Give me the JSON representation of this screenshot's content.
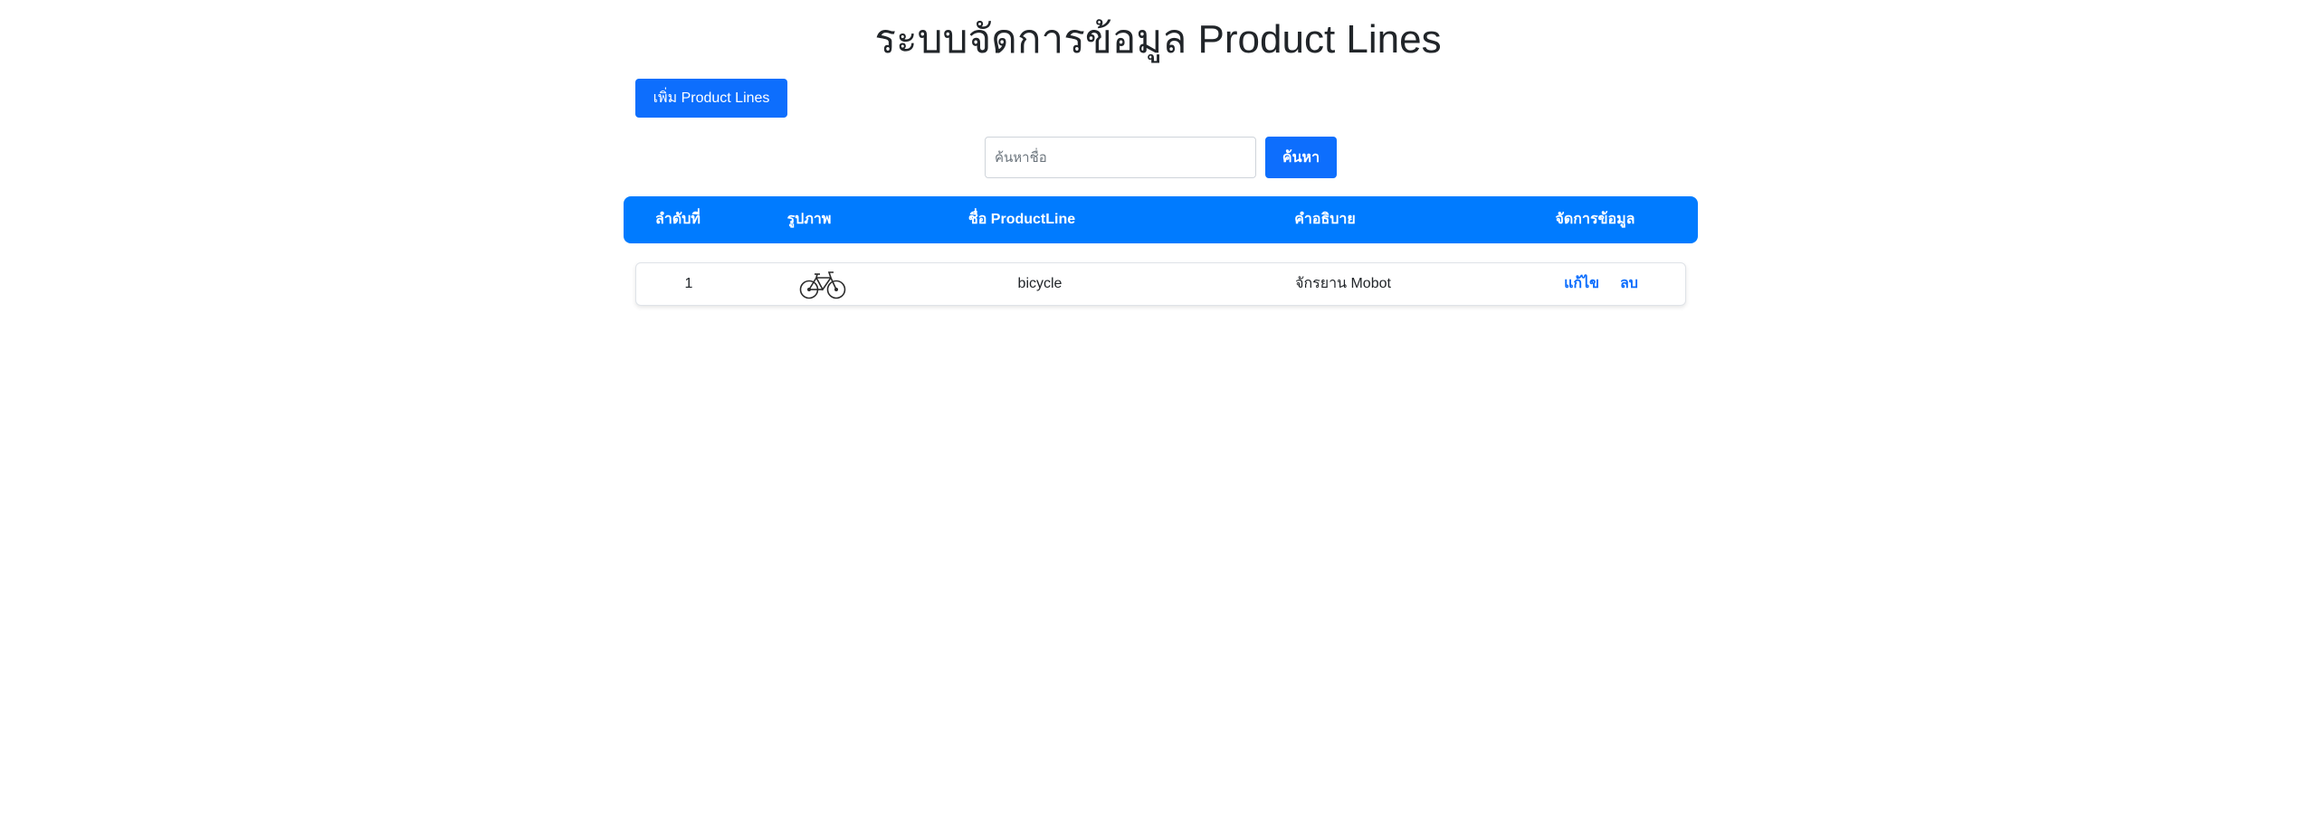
{
  "page": {
    "title": "ระบบจัดการข้อมูล Product Lines"
  },
  "toolbar": {
    "add_label": "เพิ่ม Product Lines"
  },
  "search": {
    "placeholder": "ค้นหาชื่อ",
    "value": "",
    "button_label": "ค้นหา"
  },
  "table": {
    "headers": [
      "ลำดับที่",
      "รูปภาพ",
      "ชื่อ ProductLine",
      "คำอธิบาย",
      "จัดการข้อมูล"
    ],
    "rows": [
      {
        "index": "1",
        "image_icon": "bicycle-icon",
        "name": "bicycle",
        "description": "จักรยาน Mobot",
        "edit_label": "แก้ไข",
        "delete_label": "ลบ"
      }
    ]
  },
  "colors": {
    "primary": "#0d6efd",
    "header_bg": "#007bff",
    "text": "#212529"
  }
}
